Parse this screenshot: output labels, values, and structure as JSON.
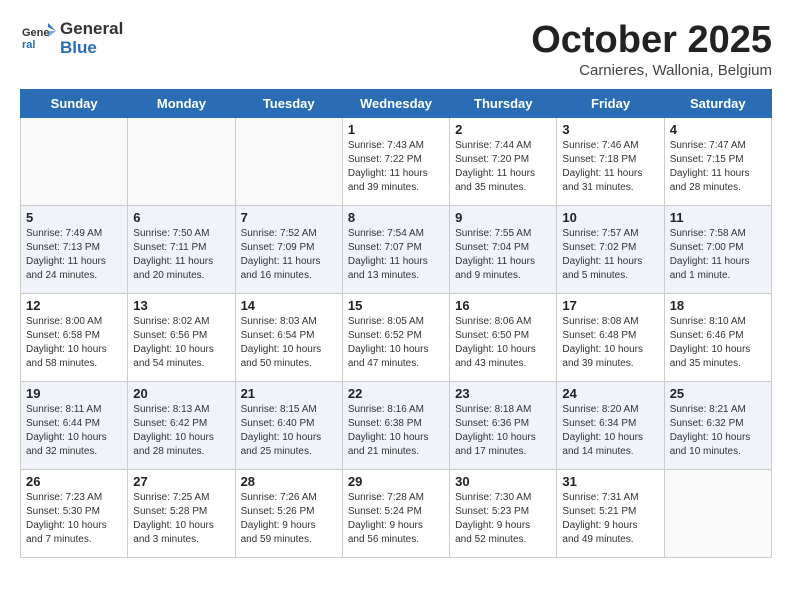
{
  "header": {
    "logo_general": "General",
    "logo_blue": "Blue",
    "month_title": "October 2025",
    "subtitle": "Carnieres, Wallonia, Belgium"
  },
  "days_of_week": [
    "Sunday",
    "Monday",
    "Tuesday",
    "Wednesday",
    "Thursday",
    "Friday",
    "Saturday"
  ],
  "weeks": [
    [
      {
        "day": "",
        "content": ""
      },
      {
        "day": "",
        "content": ""
      },
      {
        "day": "",
        "content": ""
      },
      {
        "day": "1",
        "content": "Sunrise: 7:43 AM\nSunset: 7:22 PM\nDaylight: 11 hours\nand 39 minutes."
      },
      {
        "day": "2",
        "content": "Sunrise: 7:44 AM\nSunset: 7:20 PM\nDaylight: 11 hours\nand 35 minutes."
      },
      {
        "day": "3",
        "content": "Sunrise: 7:46 AM\nSunset: 7:18 PM\nDaylight: 11 hours\nand 31 minutes."
      },
      {
        "day": "4",
        "content": "Sunrise: 7:47 AM\nSunset: 7:15 PM\nDaylight: 11 hours\nand 28 minutes."
      }
    ],
    [
      {
        "day": "5",
        "content": "Sunrise: 7:49 AM\nSunset: 7:13 PM\nDaylight: 11 hours\nand 24 minutes."
      },
      {
        "day": "6",
        "content": "Sunrise: 7:50 AM\nSunset: 7:11 PM\nDaylight: 11 hours\nand 20 minutes."
      },
      {
        "day": "7",
        "content": "Sunrise: 7:52 AM\nSunset: 7:09 PM\nDaylight: 11 hours\nand 16 minutes."
      },
      {
        "day": "8",
        "content": "Sunrise: 7:54 AM\nSunset: 7:07 PM\nDaylight: 11 hours\nand 13 minutes."
      },
      {
        "day": "9",
        "content": "Sunrise: 7:55 AM\nSunset: 7:04 PM\nDaylight: 11 hours\nand 9 minutes."
      },
      {
        "day": "10",
        "content": "Sunrise: 7:57 AM\nSunset: 7:02 PM\nDaylight: 11 hours\nand 5 minutes."
      },
      {
        "day": "11",
        "content": "Sunrise: 7:58 AM\nSunset: 7:00 PM\nDaylight: 11 hours\nand 1 minute."
      }
    ],
    [
      {
        "day": "12",
        "content": "Sunrise: 8:00 AM\nSunset: 6:58 PM\nDaylight: 10 hours\nand 58 minutes."
      },
      {
        "day": "13",
        "content": "Sunrise: 8:02 AM\nSunset: 6:56 PM\nDaylight: 10 hours\nand 54 minutes."
      },
      {
        "day": "14",
        "content": "Sunrise: 8:03 AM\nSunset: 6:54 PM\nDaylight: 10 hours\nand 50 minutes."
      },
      {
        "day": "15",
        "content": "Sunrise: 8:05 AM\nSunset: 6:52 PM\nDaylight: 10 hours\nand 47 minutes."
      },
      {
        "day": "16",
        "content": "Sunrise: 8:06 AM\nSunset: 6:50 PM\nDaylight: 10 hours\nand 43 minutes."
      },
      {
        "day": "17",
        "content": "Sunrise: 8:08 AM\nSunset: 6:48 PM\nDaylight: 10 hours\nand 39 minutes."
      },
      {
        "day": "18",
        "content": "Sunrise: 8:10 AM\nSunset: 6:46 PM\nDaylight: 10 hours\nand 35 minutes."
      }
    ],
    [
      {
        "day": "19",
        "content": "Sunrise: 8:11 AM\nSunset: 6:44 PM\nDaylight: 10 hours\nand 32 minutes."
      },
      {
        "day": "20",
        "content": "Sunrise: 8:13 AM\nSunset: 6:42 PM\nDaylight: 10 hours\nand 28 minutes."
      },
      {
        "day": "21",
        "content": "Sunrise: 8:15 AM\nSunset: 6:40 PM\nDaylight: 10 hours\nand 25 minutes."
      },
      {
        "day": "22",
        "content": "Sunrise: 8:16 AM\nSunset: 6:38 PM\nDaylight: 10 hours\nand 21 minutes."
      },
      {
        "day": "23",
        "content": "Sunrise: 8:18 AM\nSunset: 6:36 PM\nDaylight: 10 hours\nand 17 minutes."
      },
      {
        "day": "24",
        "content": "Sunrise: 8:20 AM\nSunset: 6:34 PM\nDaylight: 10 hours\nand 14 minutes."
      },
      {
        "day": "25",
        "content": "Sunrise: 8:21 AM\nSunset: 6:32 PM\nDaylight: 10 hours\nand 10 minutes."
      }
    ],
    [
      {
        "day": "26",
        "content": "Sunrise: 7:23 AM\nSunset: 5:30 PM\nDaylight: 10 hours\nand 7 minutes."
      },
      {
        "day": "27",
        "content": "Sunrise: 7:25 AM\nSunset: 5:28 PM\nDaylight: 10 hours\nand 3 minutes."
      },
      {
        "day": "28",
        "content": "Sunrise: 7:26 AM\nSunset: 5:26 PM\nDaylight: 9 hours\nand 59 minutes."
      },
      {
        "day": "29",
        "content": "Sunrise: 7:28 AM\nSunset: 5:24 PM\nDaylight: 9 hours\nand 56 minutes."
      },
      {
        "day": "30",
        "content": "Sunrise: 7:30 AM\nSunset: 5:23 PM\nDaylight: 9 hours\nand 52 minutes."
      },
      {
        "day": "31",
        "content": "Sunrise: 7:31 AM\nSunset: 5:21 PM\nDaylight: 9 hours\nand 49 minutes."
      },
      {
        "day": "",
        "content": ""
      }
    ]
  ]
}
